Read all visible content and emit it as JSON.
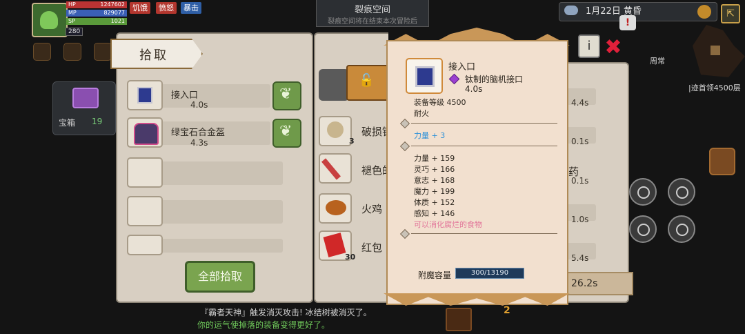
{
  "status": {
    "level": "280",
    "hp_label": "HP",
    "hp_value": "1247602",
    "mp_label": "MP",
    "mp_value": "829077",
    "sp_label": "SP",
    "sp_value": "1021",
    "tags": [
      "饥饿",
      "愤怒",
      "暴击"
    ]
  },
  "zone": {
    "name": "裂痕空间",
    "subtitle": "裂痕空间将在结束本次冒险后"
  },
  "date_text": "1月22日  黄昏",
  "chest": {
    "label": "宝箱",
    "count": "19"
  },
  "pickup_panel": {
    "title": "拾取",
    "items": [
      {
        "name": "接入口",
        "time": "4.0s"
      },
      {
        "name": "绿宝石合金盔",
        "time": "4.3s"
      }
    ],
    "pick_all_label": "全部拾取"
  },
  "middle_list": {
    "items": [
      {
        "name": "破损铁",
        "qty": "3"
      },
      {
        "name": "褪色的",
        "qty": ""
      },
      {
        "name": "火鸡",
        "qty": ""
      },
      {
        "name": "红包",
        "qty": "30"
      }
    ],
    "right_times": [
      "4.4s",
      "0.1s",
      "0.1s",
      "1.0s",
      "5.4s"
    ],
    "right_extra": "药",
    "big_time": "26.2s"
  },
  "tooltip": {
    "name": "接入口",
    "quality_text": "钛制的脑机接口",
    "time": "4.0s",
    "gear_level": "装备等级 4500",
    "trait": "耐火",
    "bonus_line": "力量 + 3",
    "stats": [
      "力量 + 159",
      "灵巧 + 166",
      "意志 + 168",
      "魔力 + 199",
      "体质 + 152",
      "感知 + 146"
    ],
    "note": "可以消化腐烂的食物",
    "capacity_label": "附魔容量",
    "capacity_value": "300/13190"
  },
  "right_hud": {
    "weekly_label": "周常",
    "boss_text": "|迹首领4500层"
  },
  "log": {
    "line1": "『霸者天神』触发消灭攻击! 冰结树被消灭了。",
    "line2": "你的运气使掉落的装备变得更好了。"
  },
  "bottom_qty": "2",
  "colors": {
    "panel_bg": "#d8cfc2",
    "tooltip_bg": "#f2e0cf",
    "accent_green": "#7aa44f",
    "stat_blue": "#2a8fd8",
    "note_pink": "#e2769a"
  }
}
